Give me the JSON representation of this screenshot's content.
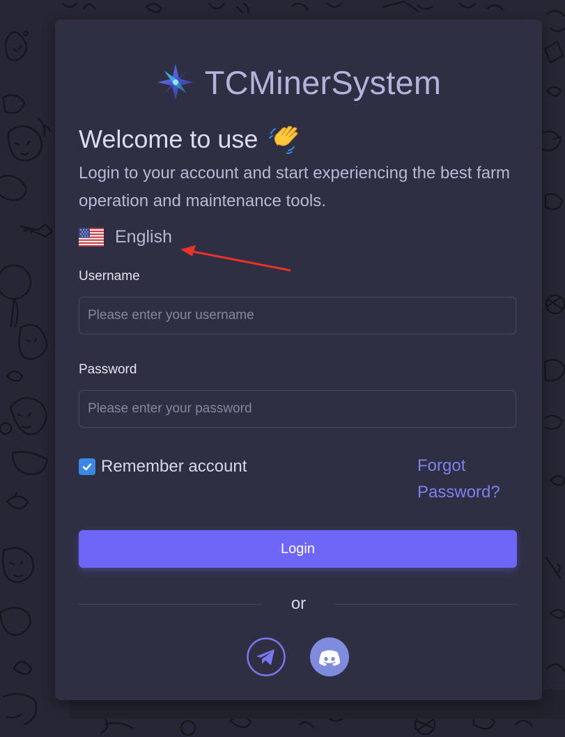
{
  "brand": {
    "name": "TCMinerSystem",
    "logo_icon": "compass-star-logo"
  },
  "welcome": {
    "title": "Welcome to use",
    "emoji_icon": "waving-hand-icon",
    "subtitle": "Login to your account and start experiencing the best farm operation and maintenance tools."
  },
  "language": {
    "label": "English",
    "flag_icon": "us-flag-icon"
  },
  "form": {
    "username_label": "Username",
    "username_placeholder": "Please enter your username",
    "username_value": "",
    "password_label": "Password",
    "password_placeholder": "Please enter your password",
    "password_value": "",
    "remember_label": "Remember account",
    "remember_checked": true,
    "forgot_label": "Forgot Password?",
    "login_label": "Login"
  },
  "divider": {
    "text": "or"
  },
  "social": [
    {
      "name": "telegram",
      "icon": "telegram-icon"
    },
    {
      "name": "discord",
      "icon": "discord-icon"
    }
  ],
  "colors": {
    "page_bg": "#262634",
    "card_bg": "#2f2f43",
    "accent": "#6e66f6",
    "link": "#7e80ef",
    "checkbox": "#3a87e6",
    "annotation_arrow": "#e8322a"
  }
}
